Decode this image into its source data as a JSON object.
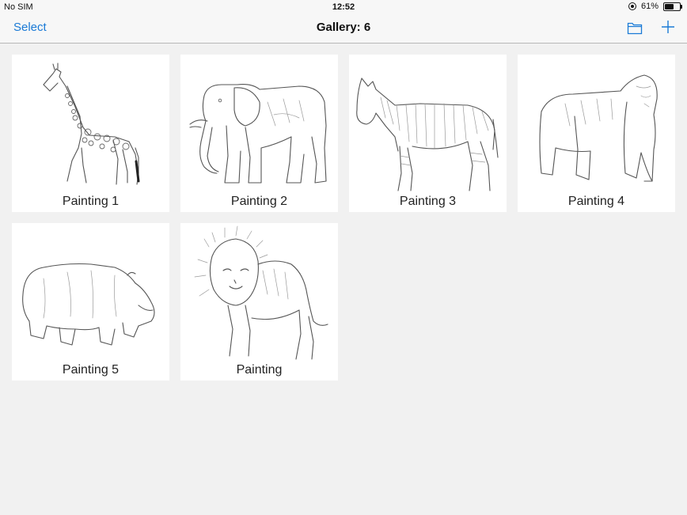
{
  "status_bar": {
    "carrier": "No SIM",
    "time": "12:52",
    "battery_text": "61%",
    "battery_level": 0.61
  },
  "nav": {
    "select_label": "Select",
    "title": "Gallery: 6",
    "folder_icon": "folder-icon",
    "add_icon": "plus-icon",
    "accent_color": "#1a7ad6"
  },
  "gallery": {
    "items": [
      {
        "label": "Painting 1",
        "subject": "giraffe"
      },
      {
        "label": "Painting 2",
        "subject": "elephant"
      },
      {
        "label": "Painting 3",
        "subject": "zebra"
      },
      {
        "label": "Painting 4",
        "subject": "gorilla"
      },
      {
        "label": "Painting 5",
        "subject": "hippopotamus"
      },
      {
        "label": "Painting",
        "subject": "lion"
      }
    ]
  }
}
